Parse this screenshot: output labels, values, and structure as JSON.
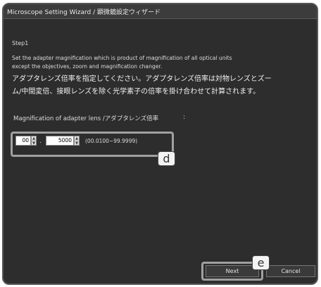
{
  "window": {
    "title": "Microscope Setting Wizard / 顕微鏡設定ウィザード"
  },
  "content": {
    "step": "Step1",
    "instruction_en_line1": "Set the adapter magnification which is product of  magnification of all optical units",
    "instruction_en_line2": " except the objectives, zoom and magnification changer.",
    "instruction_jp_line1": "アダプタレンズ倍率を指定してください。アダプタレンズ倍率は対物レンズとズー",
    "instruction_jp_line2": "ム/中間変倍、接眼レンズを除く光学素子の倍率を掛け合わせて計算されます。",
    "magnification_label": "Magnification of adapter lens /アダプタレンズ倍率",
    "colon": ":",
    "integer_value": "00",
    "decimal_separator": ".",
    "fraction_value": "5000",
    "range_hint": "(00.0100~99.9999)"
  },
  "buttons": {
    "next": "Next",
    "cancel": "Cancel"
  },
  "callouts": {
    "d": "d",
    "e": "e"
  },
  "icons": {
    "stepper_up": "▲",
    "stepper_down": "▼"
  }
}
